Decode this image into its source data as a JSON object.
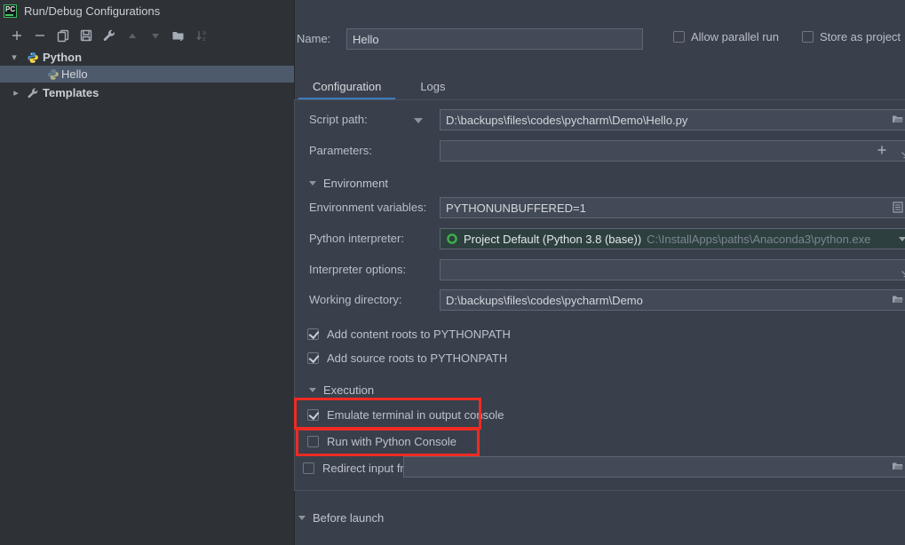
{
  "window": {
    "title": "Run/Debug Configurations"
  },
  "toolbar": {
    "icons": [
      {
        "name": "add",
        "disabled": false
      },
      {
        "name": "remove",
        "disabled": false
      },
      {
        "name": "copy-configuration",
        "disabled": false
      },
      {
        "name": "save-configuration",
        "disabled": false
      },
      {
        "name": "edit-templates",
        "disabled": false
      },
      {
        "name": "move-up",
        "disabled": true
      },
      {
        "name": "move-down",
        "disabled": true
      },
      {
        "name": "create-new-folder",
        "disabled": false
      },
      {
        "name": "sort-configurations",
        "disabled": true
      }
    ]
  },
  "tree": {
    "python_group": "Python",
    "hello_item": "Hello",
    "templates_group": "Templates"
  },
  "header": {
    "name_label": "Name:",
    "name_value": "Hello",
    "allow_parallel_run": {
      "label": "Allow parallel run",
      "checked": false
    },
    "store_as_project": {
      "label": "Store as project",
      "checked": false
    }
  },
  "tabs": {
    "configuration": "Configuration",
    "logs": "Logs"
  },
  "form": {
    "script_path": {
      "label": "Script path:",
      "value": "D:\\backups\\files\\codes\\pycharm\\Demo\\Hello.py"
    },
    "parameters": {
      "label": "Parameters:",
      "value": ""
    },
    "environment_section": "Environment",
    "environment_variables": {
      "label": "Environment variables:",
      "value": "PYTHONUNBUFFERED=1"
    },
    "python_interpreter": {
      "label": "Python interpreter:",
      "value": "Project Default (Python 3.8 (base))",
      "path": "C:\\InstallApps\\paths\\Anaconda3\\python.exe"
    },
    "interpreter_options": {
      "label": "Interpreter options:",
      "value": ""
    },
    "working_directory": {
      "label": "Working directory:",
      "value": "D:\\backups\\files\\codes\\pycharm\\Demo"
    },
    "add_content_roots": {
      "label": "Add content roots to PYTHONPATH",
      "checked": true
    },
    "add_source_roots": {
      "label": "Add source roots to PYTHONPATH",
      "checked": true
    },
    "execution_section": "Execution",
    "emulate_terminal": {
      "label": "Emulate terminal in output console",
      "checked": true,
      "highlighted": true
    },
    "run_with_python_console": {
      "label": "Run with Python Console",
      "checked": false,
      "highlighted": true
    },
    "redirect_input": {
      "label": "Redirect input from:",
      "checked": false,
      "value": ""
    },
    "before_launch_section": "Before launch"
  },
  "colors": {
    "annotation_red": "#ee2b23",
    "tab_accent": "#3f7cc0",
    "tree_selection": "#4d5a6b",
    "conda_ring_green": "#3fae4a",
    "interpreter_field_bg": "#2d403f",
    "left_panel_bg": "#2e3236",
    "right_panel_bg": "#3a404b"
  }
}
